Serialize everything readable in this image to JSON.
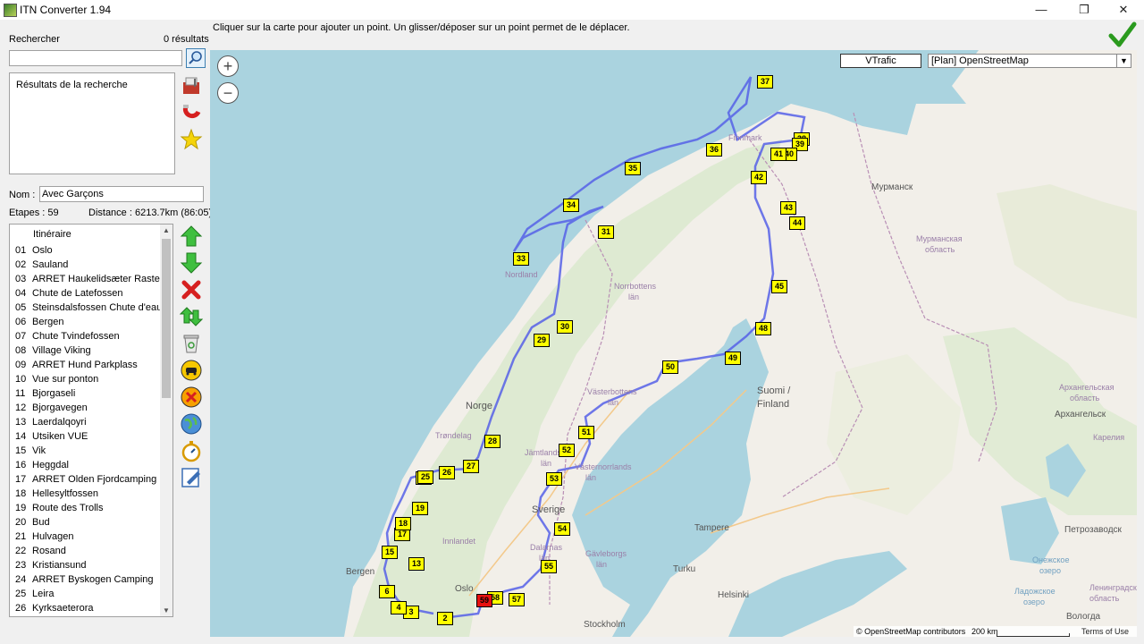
{
  "window": {
    "title": "ITN Converter 1.94",
    "minimize": "—",
    "maximize": "❐",
    "close": "✕"
  },
  "instruction": "Cliquer sur la carte pour ajouter un point. Un glisser/déposer sur un point permet de le déplacer.",
  "search": {
    "label": "Rechercher",
    "count": "0 résultats",
    "value": "",
    "results_header": "Résultats de la recherche"
  },
  "route": {
    "name_label": "Nom :",
    "name_value": "Avec Garçons",
    "steps": "Etapes : 59",
    "distance": "Distance : 6213.7km (86:05)"
  },
  "itinerary": {
    "header": "Itinéraire",
    "items": [
      {
        "num": "01",
        "label": "Oslo"
      },
      {
        "num": "02",
        "label": "Sauland"
      },
      {
        "num": "03",
        "label": "ARRET Haukelidsæter Rasteplass"
      },
      {
        "num": "04",
        "label": "Chute de Latefossen"
      },
      {
        "num": "05",
        "label": "Steinsdalsfossen Chute d'eau"
      },
      {
        "num": "06",
        "label": "Bergen"
      },
      {
        "num": "07",
        "label": "Chute Tvindefossen"
      },
      {
        "num": "08",
        "label": "Village Viking"
      },
      {
        "num": "09",
        "label": "ARRET Hund Parkplass"
      },
      {
        "num": "10",
        "label": "Vue sur ponton"
      },
      {
        "num": "11",
        "label": "Bjorgaseli"
      },
      {
        "num": "12",
        "label": "Bjorgavegen"
      },
      {
        "num": "13",
        "label": "Laerdalqoyri"
      },
      {
        "num": "14",
        "label": "Utsiken VUE"
      },
      {
        "num": "15",
        "label": "Vik"
      },
      {
        "num": "16",
        "label": "Heggdal"
      },
      {
        "num": "17",
        "label": "ARRET Olden Fjordcamping"
      },
      {
        "num": "18",
        "label": "Hellesyltfossen"
      },
      {
        "num": "19",
        "label": "Route des Trolls"
      },
      {
        "num": "20",
        "label": "Bud"
      },
      {
        "num": "21",
        "label": "Hulvagen"
      },
      {
        "num": "22",
        "label": "Rosand"
      },
      {
        "num": "23",
        "label": "Kristiansund"
      },
      {
        "num": "24",
        "label": "ARRET Byskogen Camping"
      },
      {
        "num": "25",
        "label": "Leira"
      },
      {
        "num": "26",
        "label": "Kyrksaeterora"
      }
    ]
  },
  "map": {
    "vtrafic": "VTrafic",
    "provider": "[Plan] OpenStreetMap",
    "zoom_in": "+",
    "zoom_out": "−",
    "attribution": "© OpenStreetMap contributors",
    "attribution_link": "OpenStreetMap",
    "scale": "200 km",
    "terms": "Terms of Use",
    "labels": [
      {
        "text": "Мурманск",
        "kind": "city"
      },
      {
        "text": "Мурманская",
        "kind": "region"
      },
      {
        "text": "область",
        "kind": "region"
      },
      {
        "text": "Finnmark",
        "kind": "region"
      },
      {
        "text": "Norrbottens",
        "kind": "region"
      },
      {
        "text": "län",
        "kind": "region"
      },
      {
        "text": "Nordland",
        "kind": "region"
      },
      {
        "text": "Norge",
        "kind": "country"
      },
      {
        "text": "Sverige",
        "kind": "country"
      },
      {
        "text": "Suomi /",
        "kind": "country"
      },
      {
        "text": "Finland",
        "kind": "country"
      },
      {
        "text": "Västerbottens",
        "kind": "region"
      },
      {
        "text": "län",
        "kind": "region"
      },
      {
        "text": "Trøndelag",
        "kind": "region"
      },
      {
        "text": "Jämtlands",
        "kind": "region"
      },
      {
        "text": "län",
        "kind": "region"
      },
      {
        "text": "Västernorrlands",
        "kind": "region"
      },
      {
        "text": "län",
        "kind": "region"
      },
      {
        "text": "Innlandet",
        "kind": "region"
      },
      {
        "text": "Dalarnas",
        "kind": "region"
      },
      {
        "text": "län",
        "kind": "region"
      },
      {
        "text": "Gävleborgs",
        "kind": "region"
      },
      {
        "text": "län",
        "kind": "region"
      },
      {
        "text": "Tampere",
        "kind": "city"
      },
      {
        "text": "Turku",
        "kind": "city"
      },
      {
        "text": "Helsinki",
        "kind": "city"
      },
      {
        "text": "Stockholm",
        "kind": "city"
      },
      {
        "text": "Oslo",
        "kind": "city"
      },
      {
        "text": "Bergen",
        "kind": "city"
      },
      {
        "text": "Архангельская",
        "kind": "region"
      },
      {
        "text": "область",
        "kind": "region"
      },
      {
        "text": "Архангельск",
        "kind": "city"
      },
      {
        "text": "Карелия",
        "kind": "region"
      },
      {
        "text": "Петрозаводск",
        "kind": "city"
      },
      {
        "text": "Онежское",
        "kind": "water"
      },
      {
        "text": "озеро",
        "kind": "water"
      },
      {
        "text": "Ладожское",
        "kind": "water"
      },
      {
        "text": "озеро",
        "kind": "water"
      },
      {
        "text": "Ленинградская",
        "kind": "region"
      },
      {
        "text": "область",
        "kind": "region"
      },
      {
        "text": "Вологда",
        "kind": "city"
      }
    ],
    "markers": [
      "2",
      "3",
      "4",
      "6",
      "13",
      "15",
      "17",
      "18",
      "19",
      "24",
      "25",
      "26",
      "27",
      "28",
      "29",
      "30",
      "31",
      "33",
      "34",
      "35",
      "36",
      "37",
      "38",
      "39",
      "40",
      "41",
      "42",
      "43",
      "44",
      "45",
      "48",
      "49",
      "50",
      "51",
      "52",
      "53",
      "54",
      "55",
      "57",
      "58"
    ],
    "start_marker": "59"
  }
}
